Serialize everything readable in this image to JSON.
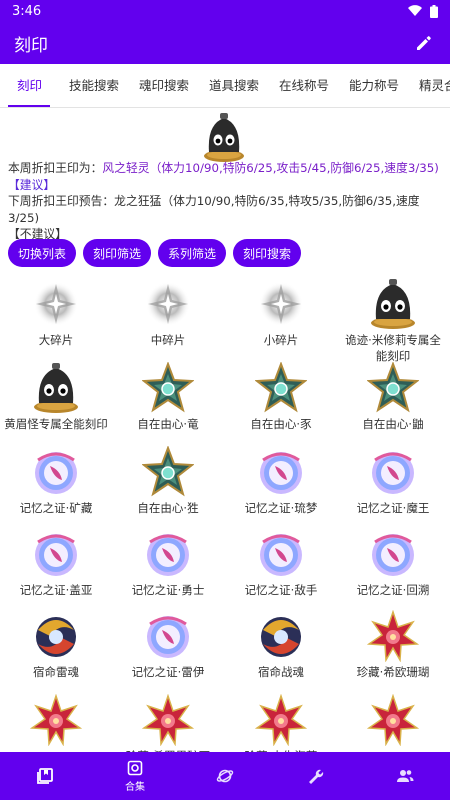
{
  "status": {
    "time": "3:46"
  },
  "app": {
    "title": "刻印"
  },
  "tabs": [
    {
      "label": "刻印"
    },
    {
      "label": "技能搜索"
    },
    {
      "label": "魂印搜索"
    },
    {
      "label": "道具搜索"
    },
    {
      "label": "在线称号"
    },
    {
      "label": "能力称号"
    },
    {
      "label": "精灵合"
    }
  ],
  "info": {
    "line1_prefix": "本周折扣王印为：",
    "line1_value": "风之轻灵（体力10/90,特防6/25,攻击5/45,防御6/25,速度3/35)",
    "line2": "【建议】",
    "line3": "下周折扣王印预告：龙之狂猛（体力10/90,特防6/35,特攻5/35,防御6/35,速度3/25)",
    "line4": "【不建议】"
  },
  "chips": [
    {
      "label": "切换列表"
    },
    {
      "label": "刻印筛选"
    },
    {
      "label": "系列筛选"
    },
    {
      "label": "刻印搜索"
    }
  ],
  "items": [
    {
      "label": "大碎片",
      "icon": "shard-icon"
    },
    {
      "label": "中碎片",
      "icon": "shard-icon"
    },
    {
      "label": "小碎片",
      "icon": "shard-icon"
    },
    {
      "label": "诡迹·米修莉专属全能刻印",
      "icon": "bomb-icon"
    },
    {
      "label": "黄眉怪专属全能刻印",
      "icon": "bomb-icon"
    },
    {
      "label": "自在由心·竜",
      "icon": "star-emblem-icon"
    },
    {
      "label": "自在由心·豕",
      "icon": "star-emblem-icon"
    },
    {
      "label": "自在由心·鼬",
      "icon": "star-emblem-icon"
    },
    {
      "label": "记忆之证·矿藏",
      "icon": "orb-icon"
    },
    {
      "label": "自在由心·狌",
      "icon": "star-emblem-icon"
    },
    {
      "label": "记忆之证·琉梦",
      "icon": "orb-icon"
    },
    {
      "label": "记忆之证·魔王",
      "icon": "orb-icon"
    },
    {
      "label": "记忆之证·盖亚",
      "icon": "orb-icon"
    },
    {
      "label": "记忆之证·勇士",
      "icon": "orb-icon"
    },
    {
      "label": "记忆之证·敌手",
      "icon": "orb-icon"
    },
    {
      "label": "记忆之证·回溯",
      "icon": "orb-icon"
    },
    {
      "label": "宿命雷魂",
      "icon": "swirl-icon"
    },
    {
      "label": "记忆之证·雷伊",
      "icon": "orb-icon"
    },
    {
      "label": "宿命战魂",
      "icon": "swirl-icon"
    },
    {
      "label": "珍藏·希欧珊瑚",
      "icon": "flower-icon"
    },
    {
      "label": "",
      "icon": "flower-icon"
    },
    {
      "label": "珍藏·希罗里矿石",
      "icon": "flower-icon"
    },
    {
      "label": "珍藏·水生海草",
      "icon": "flower-icon"
    },
    {
      "label": "",
      "icon": "flower-icon"
    }
  ],
  "bottom_nav": [
    {
      "label": "",
      "icon": "book-icon"
    },
    {
      "label": "合集",
      "icon": "collection-icon"
    },
    {
      "label": "",
      "icon": "planet-icon"
    },
    {
      "label": "",
      "icon": "wrench-icon"
    },
    {
      "label": "",
      "icon": "people-icon"
    }
  ],
  "colors": {
    "primary": "#6200ee",
    "link": "#7a1fc9"
  }
}
